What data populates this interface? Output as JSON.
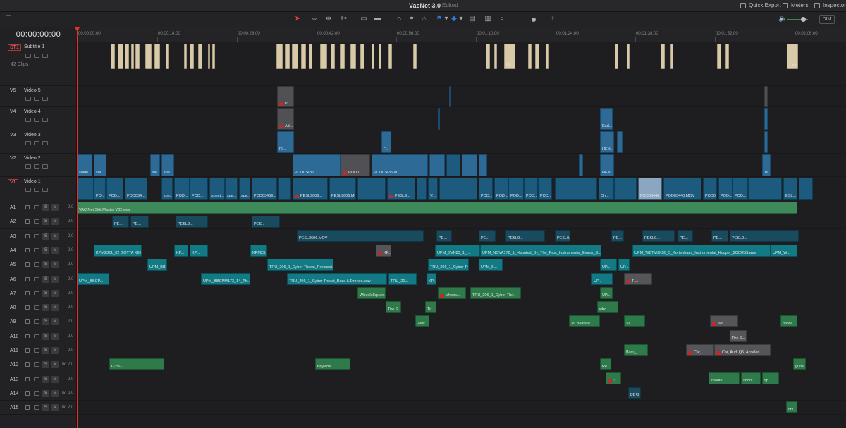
{
  "app": {
    "title": "VacNet 3.0",
    "status": "Edited",
    "quick_export": "Quick Export",
    "meters": "Meters",
    "inspector": "Inspector",
    "dim": "DIM"
  },
  "timeline": {
    "timecode": "00:00:00:00",
    "ruler_labels": [
      "00:00:00:00",
      "00:00:14:00",
      "00:00:28:00",
      "00:00:42:00",
      "00:00:56:00",
      "00:01:10:00",
      "00:01:24:00",
      "00:01:38:00",
      "00:01:52:00",
      "00:02:06:00"
    ],
    "playhead_timecode": "00:00:00:00"
  },
  "tracks": {
    "st1": {
      "id": "ST1",
      "name": "Subtitle 1",
      "clips": "42 Clips"
    },
    "v5": {
      "id": "V5",
      "name": "Video 5"
    },
    "v4": {
      "id": "V4",
      "name": "Video 4"
    },
    "v3": {
      "id": "V3",
      "name": "Video 3"
    },
    "v2": {
      "id": "V2",
      "name": "Video 2"
    },
    "v1": {
      "id": "V1",
      "name": "Video 1"
    },
    "audio": [
      {
        "id": "A1",
        "level": "2.0"
      },
      {
        "id": "A2",
        "level": "2.0"
      },
      {
        "id": "A3",
        "level": "2.0"
      },
      {
        "id": "A4",
        "level": "2.0"
      },
      {
        "id": "A5",
        "level": "2.0"
      },
      {
        "id": "A6",
        "level": "2.0"
      },
      {
        "id": "A7",
        "level": "2.0"
      },
      {
        "id": "A8",
        "level": "2.0"
      },
      {
        "id": "A9",
        "level": "2.0"
      },
      {
        "id": "A10",
        "level": "2.0"
      },
      {
        "id": "A11",
        "level": "2.0"
      },
      {
        "id": "A12",
        "level": "2.0",
        "fx": "fx"
      },
      {
        "id": "A13",
        "level": "2.0"
      },
      {
        "id": "A14",
        "level": "2.0",
        "fx": "fx"
      },
      {
        "id": "A15",
        "level": "2.0",
        "fx": "fx"
      }
    ],
    "solo_label": "S",
    "mute_label": "M"
  },
  "clips": {
    "sub": [
      "Sir ...B...",
      "...o m c..."
    ],
    "v5": [
      "P..."
    ],
    "v4": [
      "Ad...",
      "Kod..."
    ],
    "v3": [
      "Fl...",
      "F...",
      "HEN..."
    ],
    "v2": [
      "solde...",
      "sol...",
      "sw...",
      "spe...",
      "POD03436...",
      "POD0...",
      "POD03436.M...",
      "HEN...",
      "Tit..."
    ],
    "v1": [
      "PO...",
      "POD...",
      "POD034...",
      "spe...",
      "POD...",
      "POD...",
      "spect...",
      "spe...",
      "spe...",
      "POD03439...",
      "PESL9606...",
      "PESL9606.MOV",
      "PESL9...",
      "V...",
      "POD...",
      "POD...",
      "POD...",
      "POD...",
      "POD...",
      "Ch...",
      "POD03440...",
      "POD03440.MOV",
      "POD0...",
      "POD...",
      "POD...",
      "ESL..."
    ],
    "a1": "VAC Net Skit Master V02.wav",
    "a2": [
      "PE...",
      "PE...",
      "PESL9...",
      "PES..."
    ],
    "a3": [
      "PESL9606.MOV",
      "PE...",
      "PE...",
      "PESL9...",
      "PESL9...",
      "PE...",
      "PESL9...",
      "PE...",
      "PE...",
      "PESL9..."
    ],
    "a4": [
      "KPM2321_02 GOTTA KEE...",
      "KP...",
      "KP...",
      "KPM23...",
      "KP...",
      "UPM_SVN83_1_...",
      "UPM_NOVA178_1_Haunted_By_The_Past_Instrumental_Evans_S...",
      "UPM_WBTVUK50_5_Kortenhaus_Instrumental_Hooper_2020253.wav",
      "UPM_W..."
    ],
    "a5": [
      "UPM_BB...",
      "TRU_206_1_Cyber Threat_Percussi...",
      "TRU_206_1_Cyber Thr...",
      "UPM_5...",
      "UP...",
      "UP..."
    ],
    "a6": [
      "UPM_BBCP...",
      "UPM_BBCPM173_14_Th...",
      "TRU_206_1_Cyber Threat_Bass & Drones.wav",
      "TRU_20...",
      "KP...",
      "UP...",
      "Ti..."
    ],
    "a7": [
      "WheelsSquee...",
      "whoos...",
      "TRU_206_1_Cyber Thr...",
      "UP..."
    ],
    "a8": [
      "Tire S...",
      "Tir...",
      "who..."
    ],
    "a9": [
      "Zest...",
      "39 Beats P...",
      "Sl...",
      "Wh...",
      "police..."
    ],
    "a10": [
      "Tire S..."
    ],
    "a11": [
      "Bass_...",
      "Car, ...",
      "Car, Audi Q5, Acceler..."
    ],
    "a12": [
      "G35G1",
      "freywhe...",
      "Re...",
      "guns..."
    ],
    "a13": [
      "3...",
      "shoote...",
      "shoot...",
      "sp..."
    ],
    "a14": [
      "PESL..."
    ],
    "a15": [
      "otti..."
    ]
  },
  "colors": {
    "playhead": "#e03030",
    "subtitle": "#d8c9a8",
    "video": "#1c5a7e",
    "audio_green": "#2e7a4a",
    "audio_teal": "#127a84"
  }
}
